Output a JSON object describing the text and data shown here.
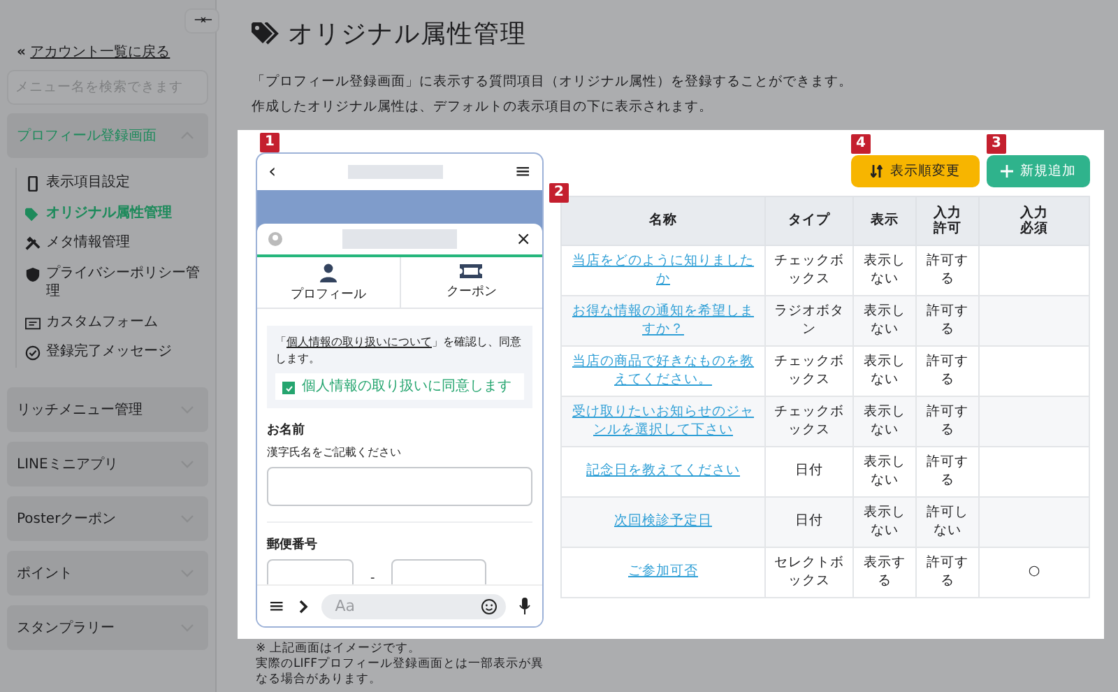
{
  "sidebar": {
    "collapse_button": "→←",
    "back_icon": "«",
    "back_link": "アカウント一覧に戻る",
    "search": {
      "placeholder": "メニュー名を検索できます"
    },
    "groups": [
      {
        "label": "プロフィール登録画面",
        "expanded": true,
        "children": [
          {
            "label": "表示項目設定",
            "selected": false
          },
          {
            "label": "オリジナル属性管理",
            "selected": true
          },
          {
            "label": "メタ情報管理",
            "selected": false
          },
          {
            "label": "プライバシーポリシー管理",
            "selected": false
          },
          {
            "label": "カスタムフォーム",
            "selected": false
          },
          {
            "label": "登録完了メッセージ",
            "selected": false
          }
        ]
      },
      {
        "label": "リッチメニュー管理",
        "expanded": false
      },
      {
        "label": "LINEミニアプリ",
        "expanded": false
      },
      {
        "label": "Posterクーポン",
        "expanded": false
      },
      {
        "label": "ポイント",
        "expanded": false
      },
      {
        "label": "スタンプラリー",
        "expanded": false
      }
    ]
  },
  "page": {
    "title": "オリジナル属性管理",
    "description": [
      "「プロフィール登録画面」に表示する質問項目（オリジナル属性）を登録することができます。",
      "作成したオリジナル属性は、デフォルトの表示項目の下に表示されます。"
    ]
  },
  "preview": {
    "badge": "1",
    "back": "‹",
    "menu": "≡",
    "close": "×",
    "tabs": [
      {
        "label": "プロフィール"
      },
      {
        "label": "クーポン"
      }
    ],
    "consent": {
      "before": "「",
      "link": "個人情報の取り扱いについて",
      "after": "」を確認し、同意します。",
      "checkbox": {
        "label": "個人情報の取り扱いに同意します",
        "checked": true
      }
    },
    "name_field": {
      "label": "お名前",
      "hint": "漢字氏名をご記載ください"
    },
    "postal": {
      "label": "郵便番号",
      "separator": "-"
    },
    "chat": {
      "placeholder": "Aa"
    },
    "note": [
      "※ 上記画面はイメージです。",
      "実際のLIFFプロフィール登録画面とは一部表示が異なる場合があります。"
    ]
  },
  "actions": [
    {
      "label": "表示順変更",
      "kind": "sort",
      "badge": "4"
    },
    {
      "label": "新規追加",
      "kind": "add",
      "badge": "3"
    }
  ],
  "table": {
    "badge": "2",
    "columns": [
      "名称",
      "タイプ",
      "表示",
      "入力許可",
      "入力必須"
    ],
    "rows": [
      {
        "name": "当店をどのように知りましたか",
        "type": "チェックボックス",
        "display": "表示しない",
        "input": "許可する"
      },
      {
        "name": "お得な情報の通知を希望しますか？",
        "type": "ラジオボタン",
        "display": "表示しない",
        "input": "許可する"
      },
      {
        "name": "当店の商品で好きなものを教えてください。",
        "type": "チェックボックス",
        "display": "表示しない",
        "input": "許可する"
      },
      {
        "name": "受け取りたいお知らせのジャンルを選択して下さい",
        "type": "チェックボックス",
        "display": "表示しない",
        "input": "許可する"
      },
      {
        "name": "記念日を教えてください",
        "type": "日付",
        "display": "表示しない",
        "input": "許可する"
      },
      {
        "name": "次回検診予定日",
        "type": "日付",
        "display": "表示しない",
        "input": "許可しない"
      },
      {
        "name": "ご参加可否",
        "type": "セレクトボックス",
        "display": "表示する",
        "input": "許可する",
        "required": "○"
      }
    ]
  }
}
